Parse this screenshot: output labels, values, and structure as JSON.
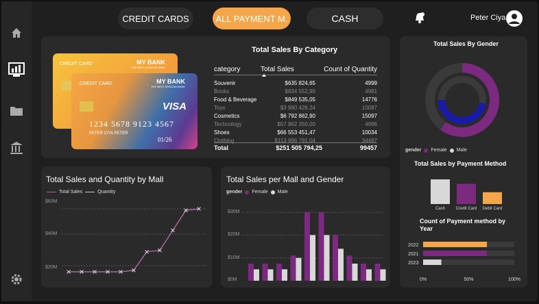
{
  "nav": {
    "tabs": [
      "CREDIT CARDS",
      "ALL PAYMENT M.",
      "CASH"
    ],
    "user_name": "Peter Ciya"
  },
  "cards": {
    "back": {
      "label": "CREDIT CARD",
      "bank": "MY BANK",
      "tagline": "THE BEST AFRICAN BANK"
    },
    "front": {
      "label": "CREDIT CARD",
      "bank": "MY BANK",
      "tagline": "THE BEST AFRICAN BANK",
      "brand": "VISA",
      "number": "1234 5678 9123 4567",
      "holder": "PETER CIYA PETER",
      "expiry": "01/26"
    }
  },
  "category_table": {
    "title": "Total Sales By Category",
    "headers": [
      "category",
      "Total Sales",
      "Count of Quantity"
    ],
    "rows": [
      {
        "category": "Souvenir",
        "sales": "$635 824,65",
        "qty": "4999",
        "dim": false
      },
      {
        "category": "Books",
        "sales": "$834 552,90",
        "qty": "4981",
        "dim": true
      },
      {
        "category": "Food & Beverage",
        "sales": "$849 535,05",
        "qty": "14776",
        "dim": false
      },
      {
        "category": "Toys",
        "sales": "$3 980 426,24",
        "qty": "10087",
        "dim": true
      },
      {
        "category": "Cosmetics",
        "sales": "$6 792 862,90",
        "qty": "15097",
        "dim": false
      },
      {
        "category": "Technology",
        "sales": "$57 862 350,00",
        "qty": "4996",
        "dim": true
      },
      {
        "category": "Shoes",
        "sales": "$66 553 451,47",
        "qty": "10034",
        "dim": false
      },
      {
        "category": "Clothing",
        "sales": "$113 996 791,04",
        "qty": "34487",
        "dim": true
      }
    ],
    "total": {
      "label": "Total",
      "sales": "$251 505 794,25",
      "qty": "99457"
    }
  },
  "gender_panel": {
    "title": "Total Sales By Gender",
    "legend_title": "gender",
    "legend": [
      "Female",
      "Male"
    ],
    "payment_title": "Total Sales by Payment Method",
    "payment_labels": [
      "Cash",
      "Credit Card",
      "Debit Card"
    ],
    "year_title": "Count of Payment method by Year",
    "year_labels": [
      "2022",
      "2021",
      "2023"
    ],
    "year_ticks": [
      "0%",
      "50%",
      "100%"
    ]
  },
  "mall_chart": {
    "title": "Total Sales and Quantity by Mall",
    "legend": [
      "Total Sales",
      "Quantity"
    ],
    "yticks": [
      "$60M",
      "$40M",
      "$20M"
    ]
  },
  "gender_mall_chart": {
    "title": "Total Sales per Mall and Gender",
    "legend_title": "gender",
    "legend": [
      "Female",
      "Male"
    ],
    "yticks": [
      "$30M",
      "$20M",
      "$10M",
      "$0M"
    ]
  },
  "colors": {
    "accent": "#f5a54a",
    "female": "#7b2a7f",
    "male": "#d8d8d8",
    "male_ring": "#1a1aa8"
  },
  "chart_data": [
    {
      "type": "pie",
      "title": "Total Sales By Gender",
      "categories": [
        "Female",
        "Male"
      ],
      "values": [
        60,
        40
      ]
    },
    {
      "type": "bar",
      "title": "Total Sales by Payment Method",
      "categories": [
        "Cash",
        "Credit Card",
        "Debit Card"
      ],
      "values": [
        100,
        82,
        48
      ]
    },
    {
      "type": "bar",
      "title": "Count of Payment method by Year",
      "categories": [
        "2022",
        "2021",
        "2023"
      ],
      "series": [
        {
          "name": "Female",
          "values": [
            70,
            70,
            20
          ]
        }
      ],
      "xlim": [
        0,
        100
      ]
    },
    {
      "type": "line",
      "title": "Total Sales and Quantity by Mall",
      "x": [
        1,
        2,
        3,
        4,
        5,
        6,
        7,
        8,
        9,
        10
      ],
      "series": [
        {
          "name": "Total Sales",
          "values": [
            14,
            14,
            14,
            14,
            14,
            15,
            27,
            28,
            41,
            54,
            55
          ]
        },
        {
          "name": "Quantity",
          "values": [
            14,
            14,
            14,
            14,
            14,
            15,
            27,
            28,
            41,
            54,
            55
          ]
        }
      ],
      "ylim": [
        0,
        60
      ]
    },
    {
      "type": "bar",
      "title": "Total Sales per Mall and Gender",
      "categories": [
        "1",
        "2",
        "3",
        "4",
        "5",
        "6",
        "7",
        "8",
        "9",
        "10"
      ],
      "series": [
        {
          "name": "Female",
          "values": [
            7.5,
            7.5,
            7.5,
            11,
            30,
            30,
            20,
            11,
            7.5,
            7.5
          ]
        },
        {
          "name": "Male",
          "values": [
            5,
            5,
            5,
            10,
            20,
            20,
            14,
            7.5,
            5,
            5
          ]
        }
      ],
      "ylim": [
        0,
        35
      ]
    }
  ]
}
